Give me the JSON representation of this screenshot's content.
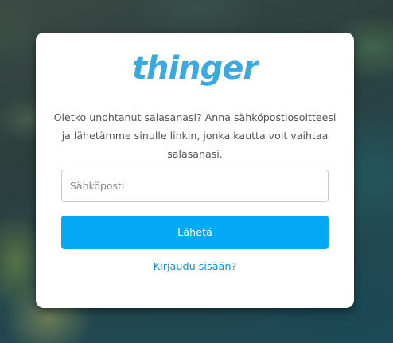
{
  "brand": {
    "logo_text": "thinger",
    "logo_color": "#3aa9df",
    "accent_color": "#03a9f4"
  },
  "reset_form": {
    "description": "Oletko unohtanut salasanasi? Anna sähköpostiosoitteesi ja lähetämme sinulle linkin, jonka kautta voit vaihtaa salasanasi.",
    "email_placeholder": "Sähköposti",
    "email_value": "",
    "submit_label": "Lähetä",
    "login_link": "Kirjaudu sisään?"
  }
}
